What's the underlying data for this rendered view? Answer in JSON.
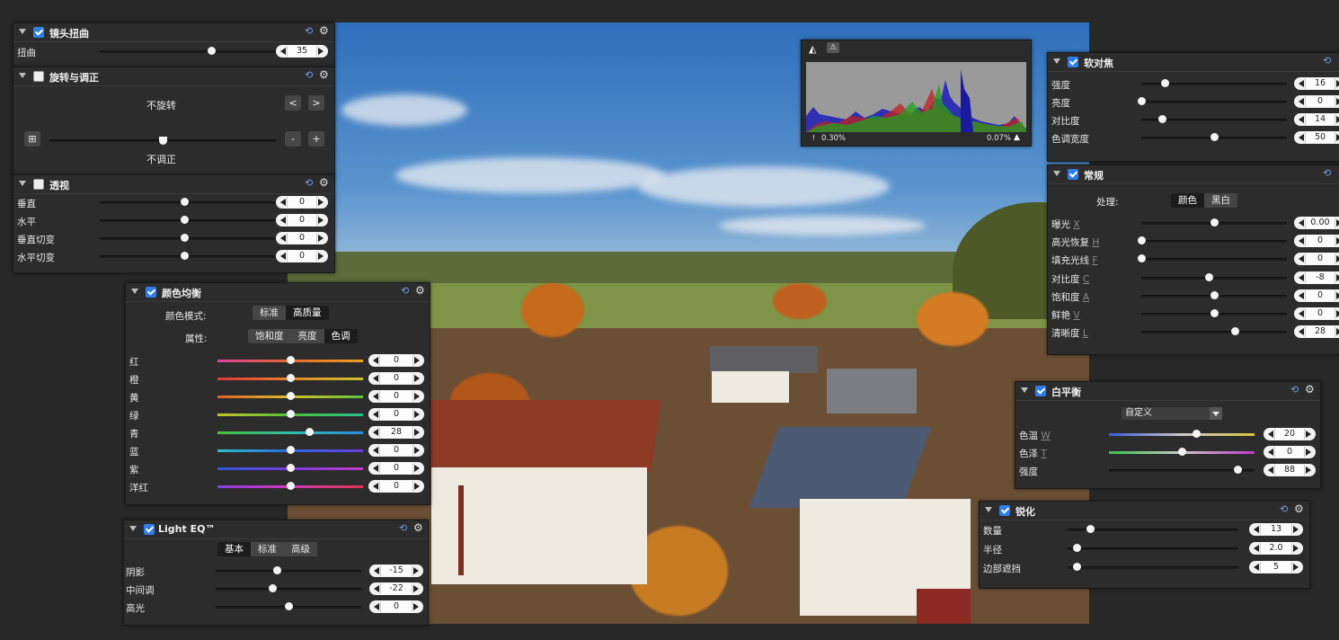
{
  "lens": {
    "title": "镜头扭曲",
    "checked": true,
    "row": {
      "label": "扭曲",
      "value": "35"
    }
  },
  "rotate": {
    "title": "旋转与调正",
    "checked": false,
    "rotation_text": "不旋转",
    "straighten_text": "不调正",
    "btn_left": "<",
    "btn_right": ">",
    "btn_minus": "-",
    "btn_plus": "+"
  },
  "perspective": {
    "title": "透视",
    "checked": false,
    "rows": [
      {
        "label": "垂直",
        "value": "0"
      },
      {
        "label": "水平",
        "value": "0"
      },
      {
        "label": "垂直切变",
        "value": "0"
      },
      {
        "label": "水平切变",
        "value": "0"
      }
    ]
  },
  "colorbal": {
    "title": "颜色均衡",
    "checked": true,
    "mode_label": "颜色模式:",
    "mode_options": [
      "标准",
      "高质量"
    ],
    "mode_selected": "高质量",
    "attr_label": "属性:",
    "attr_options": [
      "饱和度",
      "亮度",
      "色调"
    ],
    "attr_selected": "色调",
    "rows": [
      {
        "label": "红",
        "value": "0",
        "level": 0.5,
        "gradient": "linear-gradient(90deg,#e0409a,#e46a2a,#e9a020)"
      },
      {
        "label": "橙",
        "value": "0",
        "level": 0.5,
        "gradient": "linear-gradient(90deg,#e2343a,#e6822a,#c8c62a)"
      },
      {
        "label": "黄",
        "value": "0",
        "level": 0.5,
        "gradient": "linear-gradient(90deg,#e2622a,#d7c02a,#5ec63a)"
      },
      {
        "label": "绿",
        "value": "0",
        "level": 0.5,
        "gradient": "linear-gradient(90deg,#c8c62a,#4cc23a,#2ac08a)"
      },
      {
        "label": "青",
        "value": "28",
        "level": 0.63,
        "gradient": "linear-gradient(90deg,#46c23a,#2ac0a8,#2a8ce0)"
      },
      {
        "label": "蓝",
        "value": "0",
        "level": 0.5,
        "gradient": "linear-gradient(90deg,#2ac0c8,#2a6ae0,#6a3ae0)"
      },
      {
        "label": "紫",
        "value": "0",
        "level": 0.5,
        "gradient": "linear-gradient(90deg,#2a5ae0,#7a3ae0,#c23ac8)"
      },
      {
        "label": "洋红",
        "value": "0",
        "level": 0.5,
        "gradient": "linear-gradient(90deg,#8a3ae0,#d03ab8,#e0344a)"
      }
    ]
  },
  "lighteq": {
    "title": "Light EQ™",
    "checked": true,
    "tabs": [
      "基本",
      "标准",
      "高级"
    ],
    "tab_selected": "基本",
    "rows": [
      {
        "label": "阴影",
        "value": "-15",
        "level": 0.42
      },
      {
        "label": "中间调",
        "value": "-22",
        "level": 0.39
      },
      {
        "label": "高光",
        "value": "0",
        "level": 0.5
      }
    ]
  },
  "histogram": {
    "left_text": "0.30%",
    "right_text": "0.07%"
  },
  "softfocus": {
    "title": "软对焦",
    "checked": true,
    "rows": [
      {
        "label": "强度",
        "value": "16",
        "level": 0.16
      },
      {
        "label": "亮度",
        "value": "0",
        "level": 0.0
      },
      {
        "label": "对比度",
        "value": "14",
        "level": 0.14
      },
      {
        "label": "色调宽度",
        "value": "50",
        "level": 0.5
      }
    ]
  },
  "general": {
    "title": "常规",
    "checked": true,
    "process_label": "处理:",
    "process_options": [
      "颜色",
      "黑白"
    ],
    "process_selected": "颜色",
    "rows": [
      {
        "label": "曝光",
        "key": "X",
        "value": "0.00",
        "level": 0.5
      },
      {
        "label": "高光恢复",
        "key": "H",
        "value": "0",
        "level": 0.0
      },
      {
        "label": "填充光线",
        "key": "F",
        "value": "0",
        "level": 0.0
      },
      {
        "label": "对比度",
        "key": "C",
        "value": "-8",
        "level": 0.46
      },
      {
        "label": "饱和度",
        "key": "A",
        "value": "0",
        "level": 0.5
      },
      {
        "label": "鲜艳",
        "key": "V",
        "value": "0",
        "level": 0.5
      },
      {
        "label": "清晰度",
        "key": "L",
        "value": "28",
        "level": 0.64
      }
    ]
  },
  "whitebalance": {
    "title": "白平衡",
    "checked": true,
    "preset": "自定义",
    "rows": [
      {
        "label": "色温",
        "key": "W",
        "value": "20",
        "level": 0.6,
        "gradient": "linear-gradient(90deg,#3a5ad8,#c9c9c9,#d8c43a)"
      },
      {
        "label": "色泽",
        "key": "T",
        "value": "0",
        "level": 0.5,
        "gradient": "linear-gradient(90deg,#3ac04a,#c9c9c9,#c03ac8)"
      },
      {
        "label": "强度",
        "key": "",
        "value": "88",
        "level": 0.88,
        "gradient": ""
      }
    ]
  },
  "sharpen": {
    "title": "锐化",
    "checked": true,
    "rows": [
      {
        "label": "数量",
        "value": "13",
        "level": 0.13
      },
      {
        "label": "半径",
        "value": "2.0",
        "level": 0.05
      },
      {
        "label": "边部遮挡",
        "value": "5",
        "level": 0.05
      }
    ]
  },
  "icons": {
    "reset": "reset-icon",
    "gear": "gear-icon"
  }
}
